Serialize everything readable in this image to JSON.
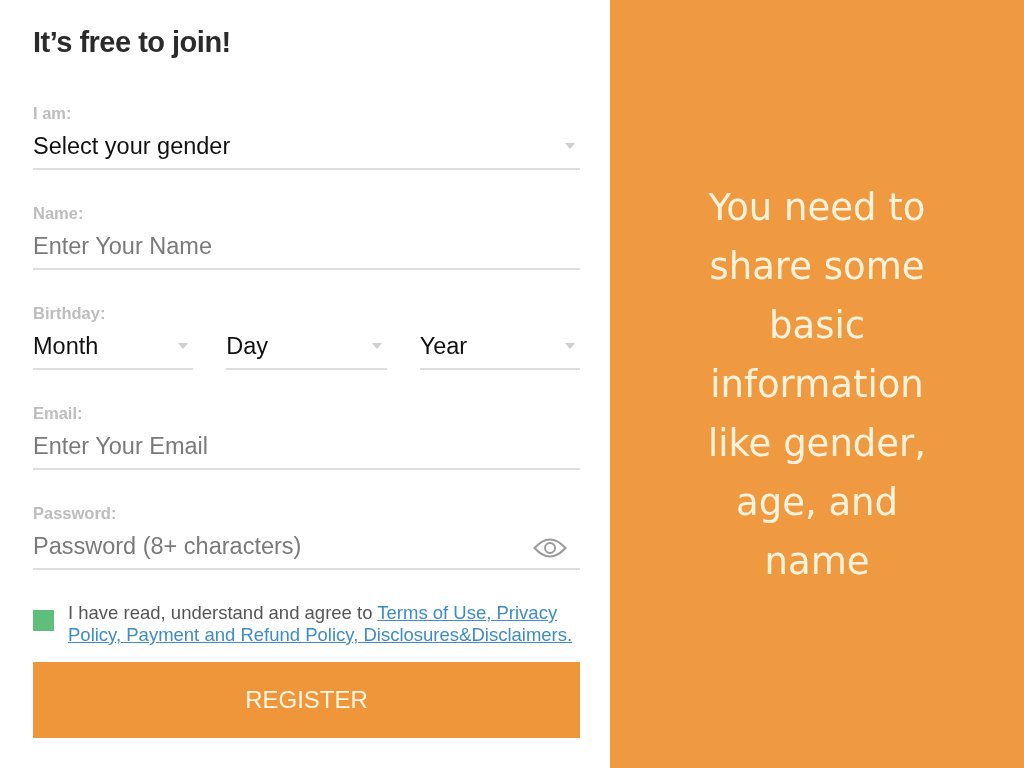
{
  "title": "It’s free to join!",
  "fields": [
    {
      "kind": "select",
      "label": "I am:",
      "value": "Select your gender"
    },
    {
      "kind": "text",
      "label": "Name:",
      "placeholder": "Enter Your Name"
    },
    {
      "kind": "select_group",
      "label": "Birthday:",
      "selects": [
        {
          "value": "Month"
        },
        {
          "value": "Day"
        },
        {
          "value": "Year"
        }
      ]
    },
    {
      "kind": "text",
      "label": "Email:",
      "placeholder": "Enter Your Email"
    },
    {
      "kind": "password",
      "label": "Password:",
      "placeholder": "Password (8+ characters)"
    }
  ],
  "agreement": {
    "checked": true,
    "text": "I have read, understand and agree to",
    "links": [
      "Terms of Use, Privacy",
      "Policy, Payment and Refund Policy, Disclosures&Disclaimers."
    ]
  },
  "register_button": "REGISTER",
  "side_message": "You need to share some basic information like gender, age, and name"
}
